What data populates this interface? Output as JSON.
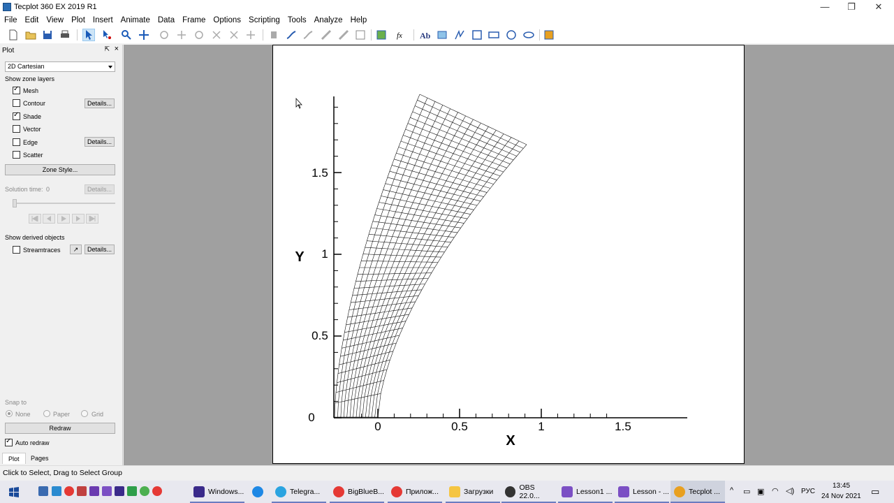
{
  "window": {
    "title": "Tecplot 360 EX 2019 R1",
    "minimize": "—",
    "maximize": "❐",
    "close": "✕"
  },
  "menu": [
    "File",
    "Edit",
    "View",
    "Plot",
    "Insert",
    "Animate",
    "Data",
    "Frame",
    "Options",
    "Scripting",
    "Tools",
    "Analyze",
    "Help"
  ],
  "sidebar": {
    "title": "Plot",
    "plot_type": "2D Cartesian",
    "zone_layers_label": "Show zone layers",
    "layers": [
      {
        "label": "Mesh",
        "checked": true,
        "details": ""
      },
      {
        "label": "Contour",
        "checked": false,
        "details": "Details..."
      },
      {
        "label": "Shade",
        "checked": true,
        "details": ""
      },
      {
        "label": "Vector",
        "checked": false,
        "details": ""
      },
      {
        "label": "Edge",
        "checked": false,
        "details": "Details..."
      },
      {
        "label": "Scatter",
        "checked": false,
        "details": ""
      }
    ],
    "zone_style": "Zone Style...",
    "solution_time_label": "Solution time:",
    "solution_time_value": "0",
    "solution_details": "Details...",
    "derived_label": "Show derived objects",
    "streamtraces": {
      "label": "Streamtraces",
      "checked": false,
      "details": "Details..."
    },
    "snap_label": "Snap to",
    "snap_options": [
      "None",
      "Paper",
      "Grid"
    ],
    "snap_selected": "None",
    "redraw": "Redraw",
    "auto_redraw": {
      "label": "Auto redraw",
      "checked": true
    },
    "tabs": [
      "Plot",
      "Pages"
    ]
  },
  "plot": {
    "xlabel": "X",
    "ylabel": "Y",
    "x_ticks": [
      "0",
      "0.5",
      "1",
      "1.5"
    ],
    "y_ticks": [
      "0",
      "0.5",
      "1",
      "1.5"
    ]
  },
  "status": "Click to Select, Drag to Select Group",
  "taskbar": {
    "apps": [
      {
        "label": "Windows...",
        "color": "#3a2a8a"
      },
      {
        "label": "",
        "color": "#1e88e5"
      },
      {
        "label": "Telegra...",
        "color": "#2aa3e0"
      },
      {
        "label": "BigBlueB...",
        "color": "#e53935"
      },
      {
        "label": "Прилож...",
        "color": "#e53935"
      },
      {
        "label": "Загрузки",
        "color": "#f5c542"
      },
      {
        "label": "OBS 22.0...",
        "color": "#333333"
      },
      {
        "label": "Lesson1 ...",
        "color": "#7b4fc4"
      },
      {
        "label": "Lesson - ...",
        "color": "#7b4fc4"
      },
      {
        "label": "Tecplot ...",
        "color": "#e8a020"
      }
    ],
    "lang": "РУС",
    "time": "13:45",
    "date": "24 Nov 2021"
  }
}
